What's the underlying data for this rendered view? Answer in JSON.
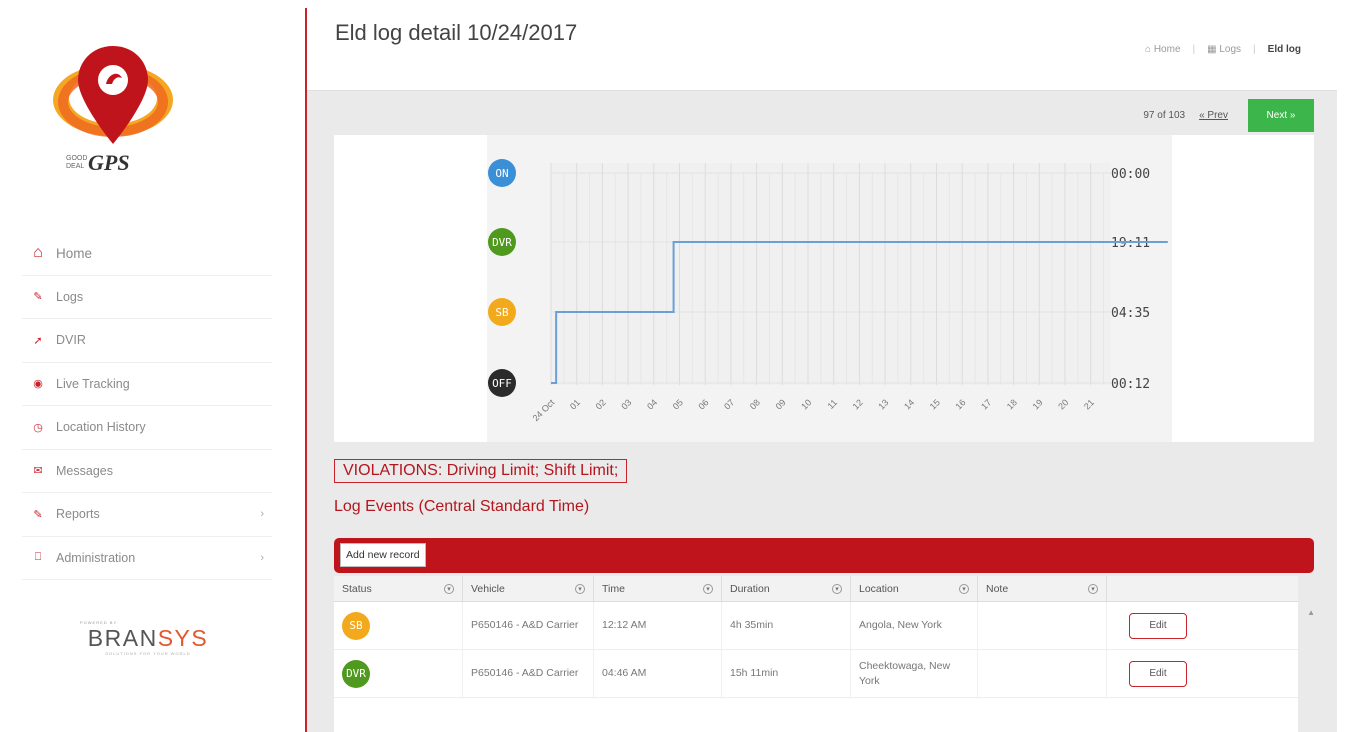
{
  "app": {
    "logo_small": "GOOD DEAL",
    "logo_text": "GPS",
    "page_title": "Eld log detail 10/24/2017"
  },
  "breadcrumb": [
    {
      "label": "Home",
      "icon": "home-icon"
    },
    {
      "label": "Logs",
      "icon": "calendar-icon"
    },
    {
      "label": "Eld log"
    }
  ],
  "sidebar": {
    "items": [
      {
        "label": "Home",
        "icon": "home-icon"
      },
      {
        "label": "Logs",
        "icon": "edit-icon"
      },
      {
        "label": "DVIR",
        "icon": "wrench-icon"
      },
      {
        "label": "Live Tracking",
        "icon": "eye-icon"
      },
      {
        "label": "Location History",
        "icon": "clock-icon"
      },
      {
        "label": "Messages",
        "icon": "envelope-icon"
      },
      {
        "label": "Reports",
        "icon": "edit-icon",
        "chevron": "›"
      },
      {
        "label": "Administration",
        "icon": "laptop-icon",
        "chevron": "›"
      }
    ],
    "powered_by": "POWERED BY",
    "brand_main": "BRAN",
    "brand_accent": "SYS",
    "brand_tagline": "SOLUTIONS FOR YOUR WORLD"
  },
  "pager": {
    "count": "97 of 103",
    "prev": "« Prev",
    "next": "Next »"
  },
  "chart_data": {
    "type": "line",
    "status_labels": [
      "ON",
      "DVR",
      "SB",
      "OFF"
    ],
    "status_colors": {
      "ON": "#3a8fd6",
      "DVR": "#4f9a1e",
      "SB": "#f3a91c",
      "OFF": "#2b2b2b"
    },
    "totals": [
      "00:00",
      "19:11",
      "04:35",
      "00:12"
    ],
    "x_ticks": [
      "24 Oct",
      "01",
      "02",
      "03",
      "04",
      "05",
      "06",
      "07",
      "08",
      "09",
      "10",
      "11",
      "12",
      "13",
      "14",
      "15",
      "16",
      "17",
      "18",
      "19",
      "20",
      "21"
    ],
    "steps": [
      {
        "hour": 0,
        "status": "OFF"
      },
      {
        "hour": 0.2,
        "status": "SB"
      },
      {
        "hour": 4.77,
        "status": "DVR"
      },
      {
        "hour": 24,
        "status": "DVR"
      }
    ],
    "line_color": "#6a9fd8"
  },
  "violations": "VIOLATIONS: Driving Limit; Shift Limit;",
  "log_events_title": "Log Events (Central Standard Time)",
  "table": {
    "add_label": "Add new record",
    "columns": [
      "Status",
      "Vehicle",
      "Time",
      "Duration",
      "Location",
      "Note"
    ],
    "rows": [
      {
        "status": "SB",
        "vehicle": "P650146 - A&D Carrier",
        "time": "12:12 AM",
        "duration": "4h 35min",
        "location": "Angola, New York",
        "note": "",
        "action": "Edit"
      },
      {
        "status": "DVR",
        "vehicle": "P650146 - A&D Carrier",
        "time": "04:46 AM",
        "duration": "15h 11min",
        "location": "Cheektowaga, New York",
        "note": "",
        "action": "Edit"
      }
    ]
  }
}
